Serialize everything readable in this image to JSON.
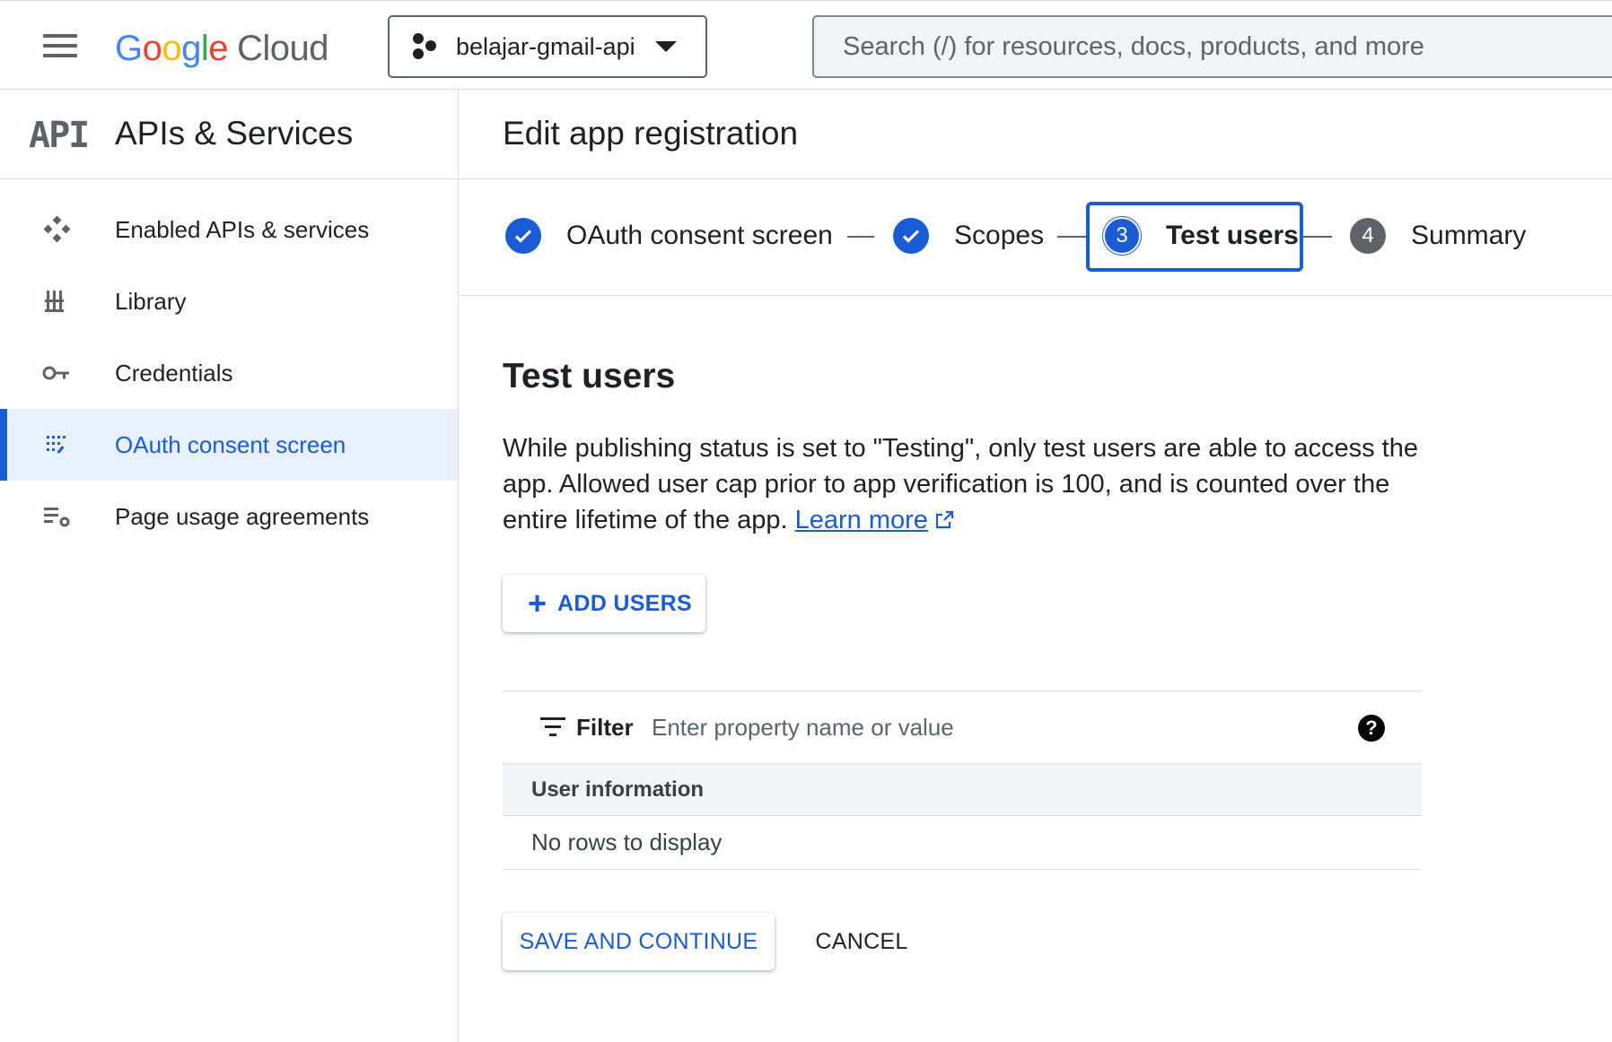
{
  "header": {
    "logo_google": [
      "G",
      "o",
      "o",
      "g",
      "l",
      "e"
    ],
    "logo_cloud": "Cloud",
    "project_name": "belajar-gmail-api",
    "search_placeholder": "Search (/) for resources, docs, products, and more"
  },
  "sidebar": {
    "api_logo": "API",
    "title": "APIs & Services",
    "items": [
      {
        "label": "Enabled APIs & services",
        "icon": "enabled-apis-icon"
      },
      {
        "label": "Library",
        "icon": "library-icon"
      },
      {
        "label": "Credentials",
        "icon": "key-icon"
      },
      {
        "label": "OAuth consent screen",
        "icon": "oauth-consent-icon",
        "active": true
      },
      {
        "label": "Page usage agreements",
        "icon": "usage-agreements-icon"
      }
    ]
  },
  "main": {
    "page_title": "Edit app registration",
    "steps": [
      {
        "label": "OAuth consent screen",
        "state": "done"
      },
      {
        "label": "Scopes",
        "state": "done"
      },
      {
        "number": "3",
        "label": "Test users",
        "state": "active"
      },
      {
        "number": "4",
        "label": "Summary",
        "state": "pending"
      }
    ],
    "section_title": "Test users",
    "description": "While publishing status is set to \"Testing\", only test users are able to access the app. Allowed user cap prior to app verification is 100, and is counted over the entire lifetime of the app. ",
    "learn_more": "Learn more",
    "add_users_label": "ADD USERS",
    "table": {
      "filter_label": "Filter",
      "filter_placeholder": "Enter property name or value",
      "help_glyph": "?",
      "column_header": "User information",
      "empty_text": "No rows to display"
    },
    "save_label": "SAVE AND CONTINUE",
    "cancel_label": "CANCEL"
  },
  "colors": {
    "accent": "#1a5bd6",
    "active_nav_bg": "#e8f0fe",
    "text": "#202124",
    "muted": "#5f6368"
  }
}
